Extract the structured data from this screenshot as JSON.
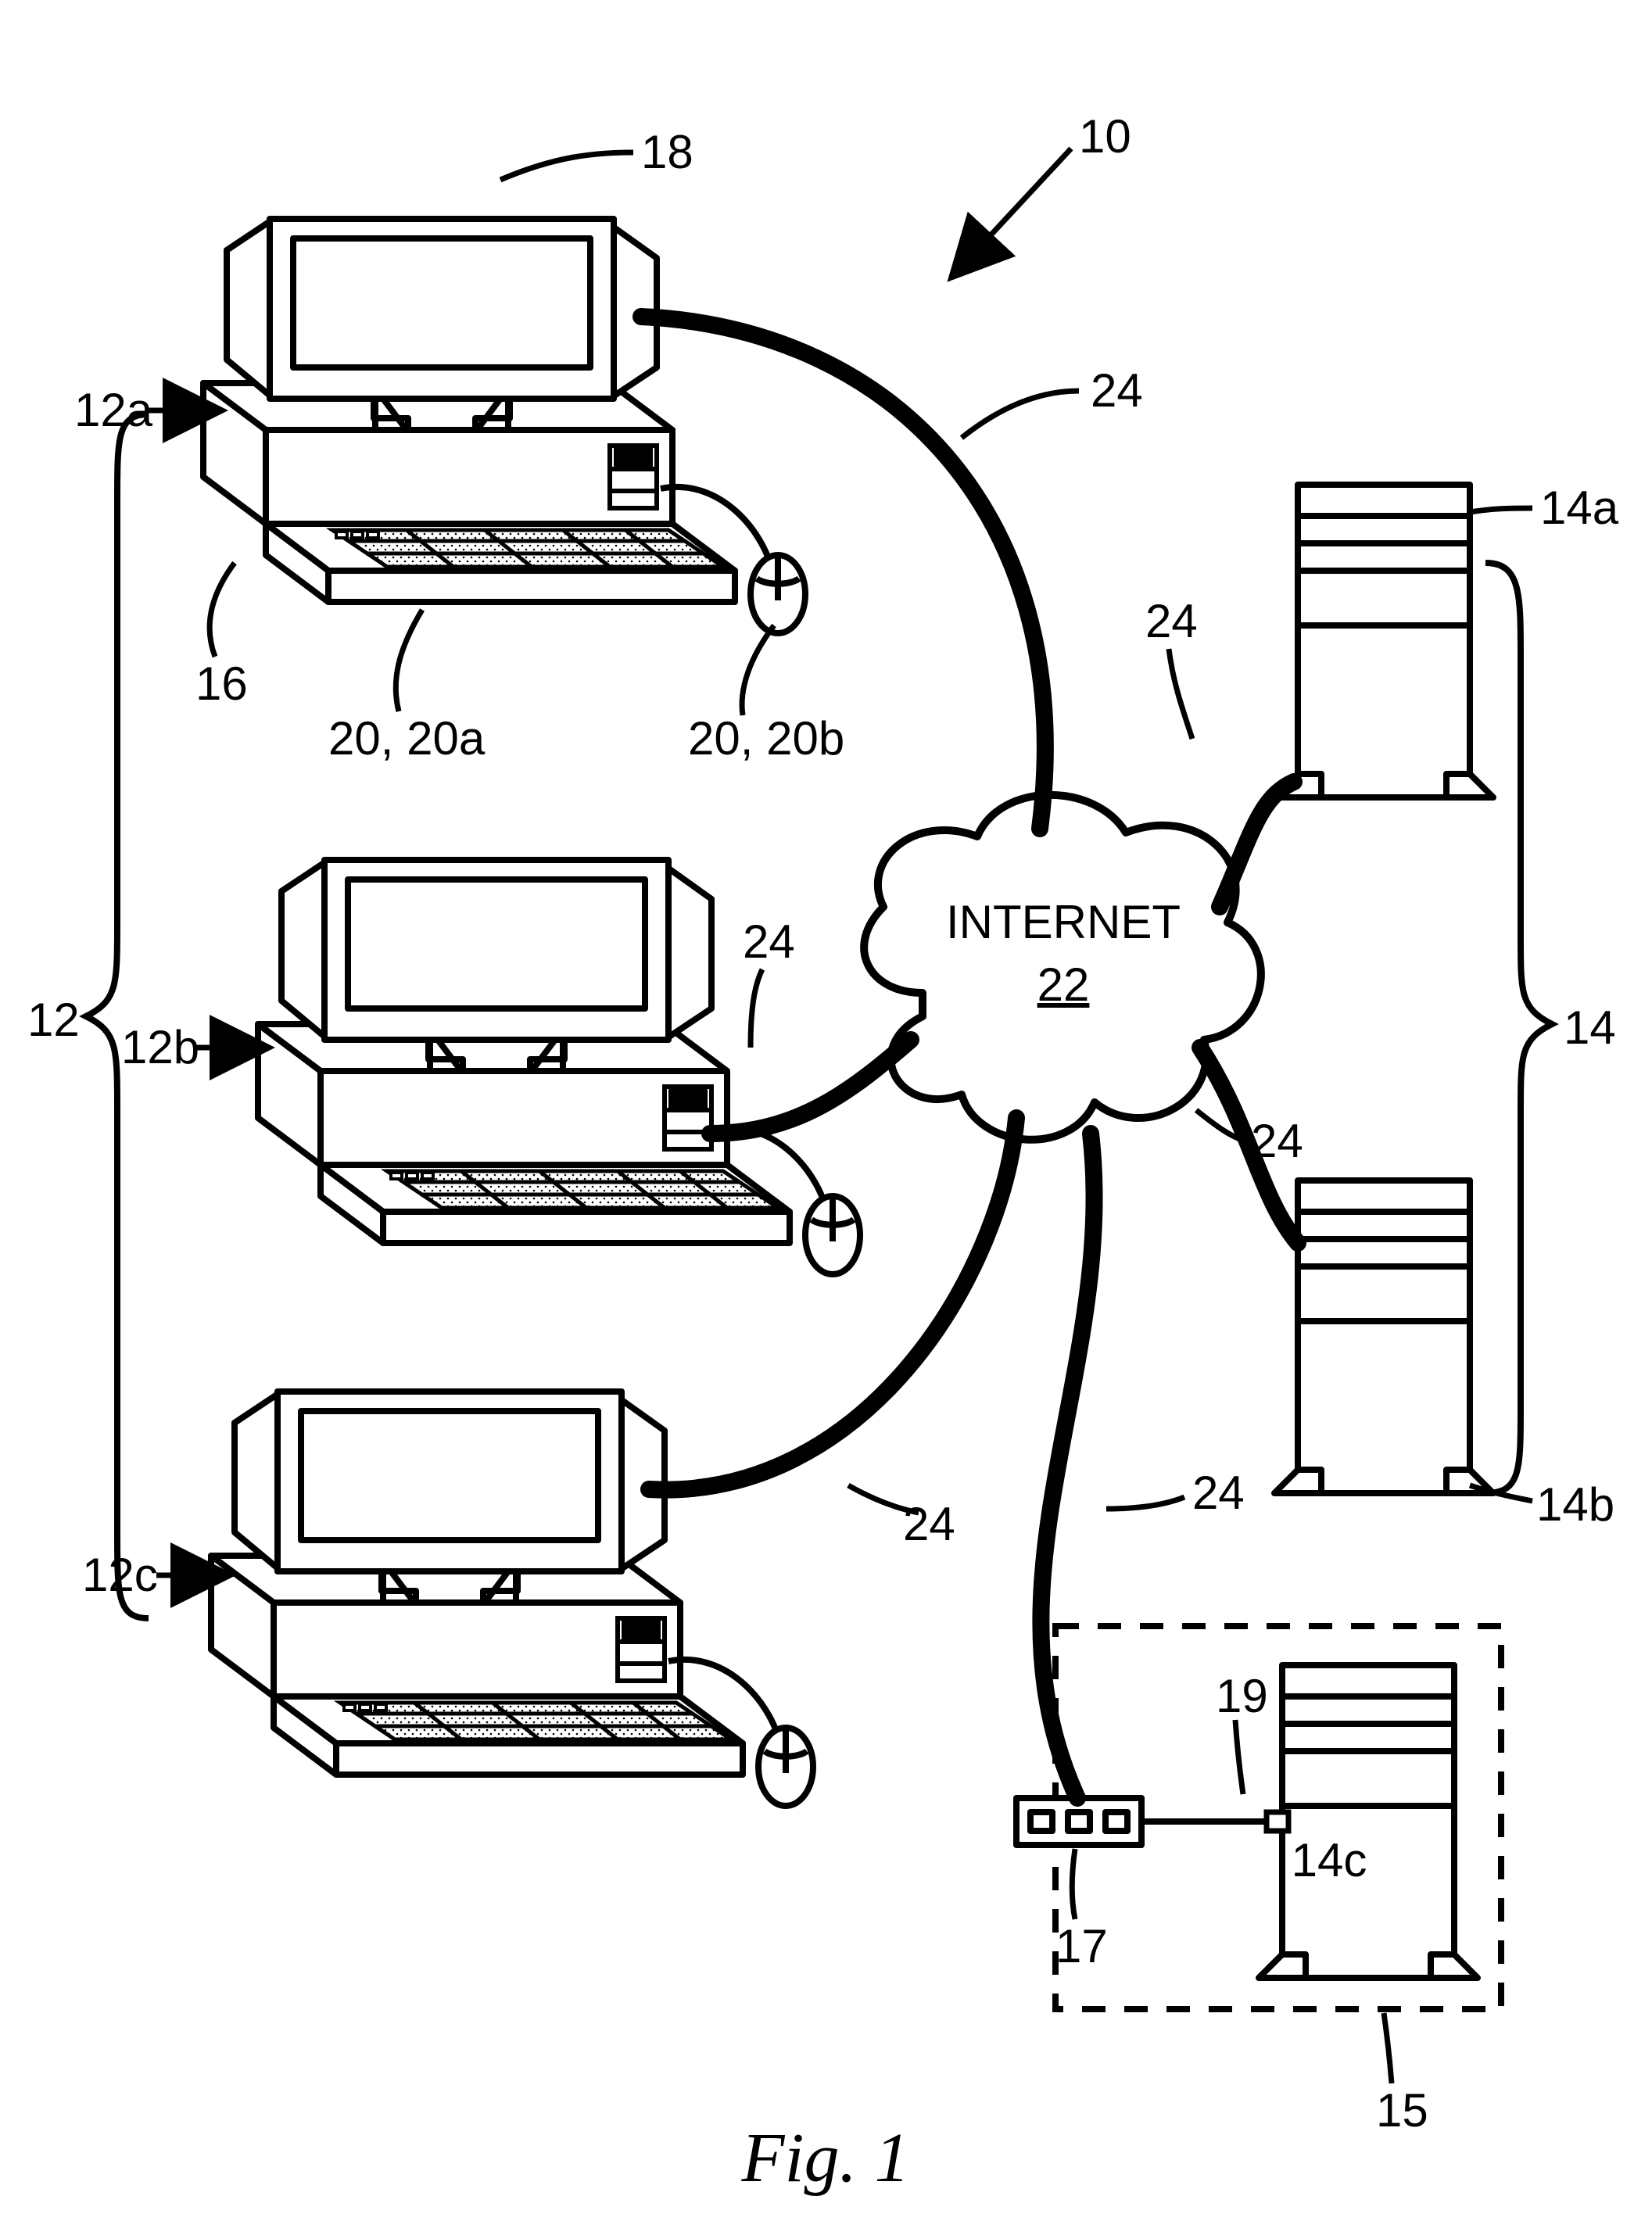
{
  "figure": {
    "caption": "Fig. 1",
    "system_ref": "10",
    "clients_group": "12",
    "client_a": "12a",
    "client_b": "12b",
    "client_c": "12c",
    "monitor_ref": "18",
    "case_ref": "16",
    "keyboard_ref": "20, 20a",
    "mouse_ref": "20, 20b",
    "servers_group": "14",
    "server_a": "14a",
    "server_b": "14b",
    "server_c": "14c",
    "enclosure_ref": "15",
    "switch_ref": "17",
    "switch_link_ref": "19",
    "cloud_label": "INTERNET",
    "cloud_ref": "22",
    "cable_ref": "24"
  }
}
